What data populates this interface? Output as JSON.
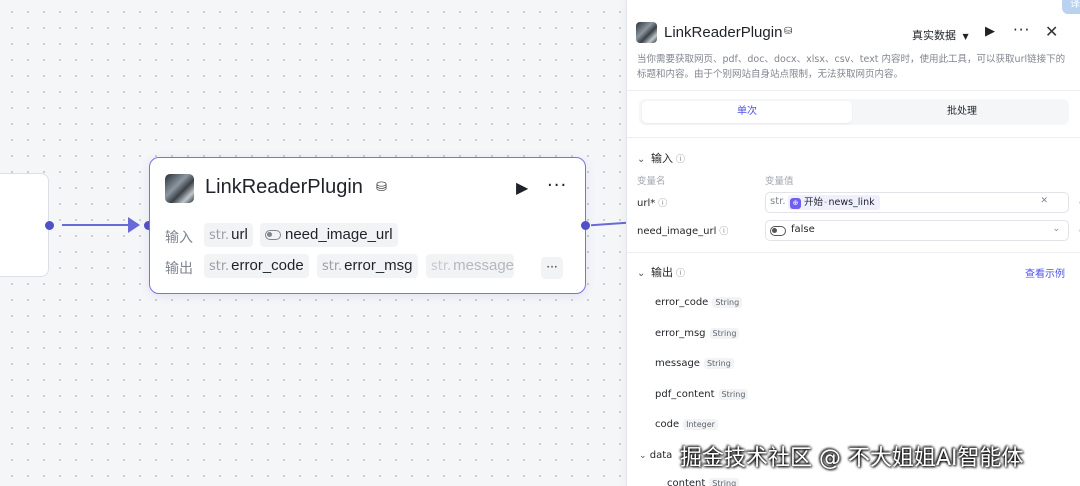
{
  "node": {
    "title": "LinkReaderPlugin",
    "input_label": "输入",
    "output_label": "输出",
    "inputs": [
      {
        "type": "str.",
        "name": "url"
      },
      {
        "type": "toggle",
        "name": "need_image_url"
      }
    ],
    "outputs": [
      {
        "type": "str.",
        "name": "error_code"
      },
      {
        "type": "str.",
        "name": "error_msg"
      },
      {
        "type": "str.",
        "name": "message"
      }
    ],
    "more": "···"
  },
  "panel": {
    "title": "LinkReaderPlugin",
    "dataset": "真实数据",
    "description": "当你需要获取网页、pdf、doc、docx、xlsx、csv、text 内容时，使用此工具，可以获取url链接下的标题和内容。由于个别网站自身站点限制，无法获取网页内容。",
    "tabs": [
      "单次",
      "批处理"
    ],
    "input_section": "输入",
    "col_var_name": "变量名",
    "col_var_value": "变量值",
    "fields": {
      "url": {
        "name": "url*",
        "type": "str.",
        "ref_source": "开始",
        "ref_sep": "-",
        "ref_var": "news_link"
      },
      "need_image_url": {
        "name": "need_image_url",
        "value": "false"
      }
    },
    "output_section": "输出",
    "view_example": "查看示例",
    "outputs": [
      {
        "name": "error_code",
        "type": "String"
      },
      {
        "name": "error_msg",
        "type": "String"
      },
      {
        "name": "message",
        "type": "String"
      },
      {
        "name": "pdf_content",
        "type": "String"
      },
      {
        "name": "code",
        "type": "Integer"
      },
      {
        "name": "data",
        "type": ""
      },
      {
        "name": "content",
        "type": "String"
      }
    ]
  },
  "watermark": "掘金技术社区 @ 不大姐姐AI智能体",
  "corner_badge": "译",
  "colors": {
    "accent": "#4d53e8",
    "edge": "#6a6ad6",
    "node_border": "#7a72e0"
  },
  "icons": [
    "plugin-logo-icon",
    "store-icon",
    "play-icon",
    "more-icon",
    "close-icon",
    "chevron-down-icon",
    "info-icon",
    "clear-icon",
    "settings-circle-icon",
    "toggle-icon",
    "start-node-icon"
  ]
}
